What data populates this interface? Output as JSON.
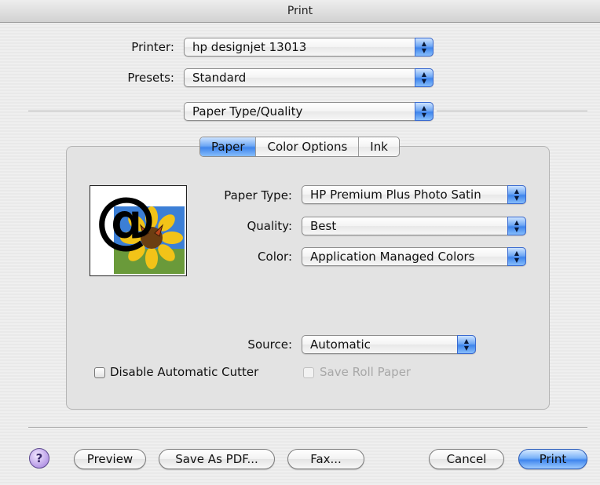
{
  "window": {
    "title": "Print"
  },
  "printer": {
    "label": "Printer:",
    "value": "hp designjet 13013"
  },
  "presets": {
    "label": "Presets:",
    "value": "Standard"
  },
  "panel_select": {
    "value": "Paper Type/Quality"
  },
  "tabs": [
    {
      "label": "Paper",
      "active": true
    },
    {
      "label": "Color Options",
      "active": false
    },
    {
      "label": "Ink",
      "active": false
    }
  ],
  "paper": {
    "paper_type": {
      "label": "Paper Type:",
      "value": "HP Premium Plus Photo Satin"
    },
    "quality": {
      "label": "Quality:",
      "value": "Best"
    },
    "color": {
      "label": "Color:",
      "value": "Application Managed Colors"
    },
    "source": {
      "label": "Source:",
      "value": "Automatic"
    },
    "disable_cutter": {
      "label": "Disable Automatic Cutter",
      "checked": false
    },
    "save_roll_paper": {
      "label": "Save Roll Paper",
      "checked": false,
      "enabled": false
    },
    "preview_icon": "at-sign-sunflower-butterfly"
  },
  "buttons": {
    "help": "?",
    "preview": "Preview",
    "save_pdf": "Save As PDF...",
    "fax": "Fax...",
    "cancel": "Cancel",
    "print": "Print"
  },
  "colors": {
    "accent": "#3f85ec",
    "help": "#b79ae6"
  }
}
